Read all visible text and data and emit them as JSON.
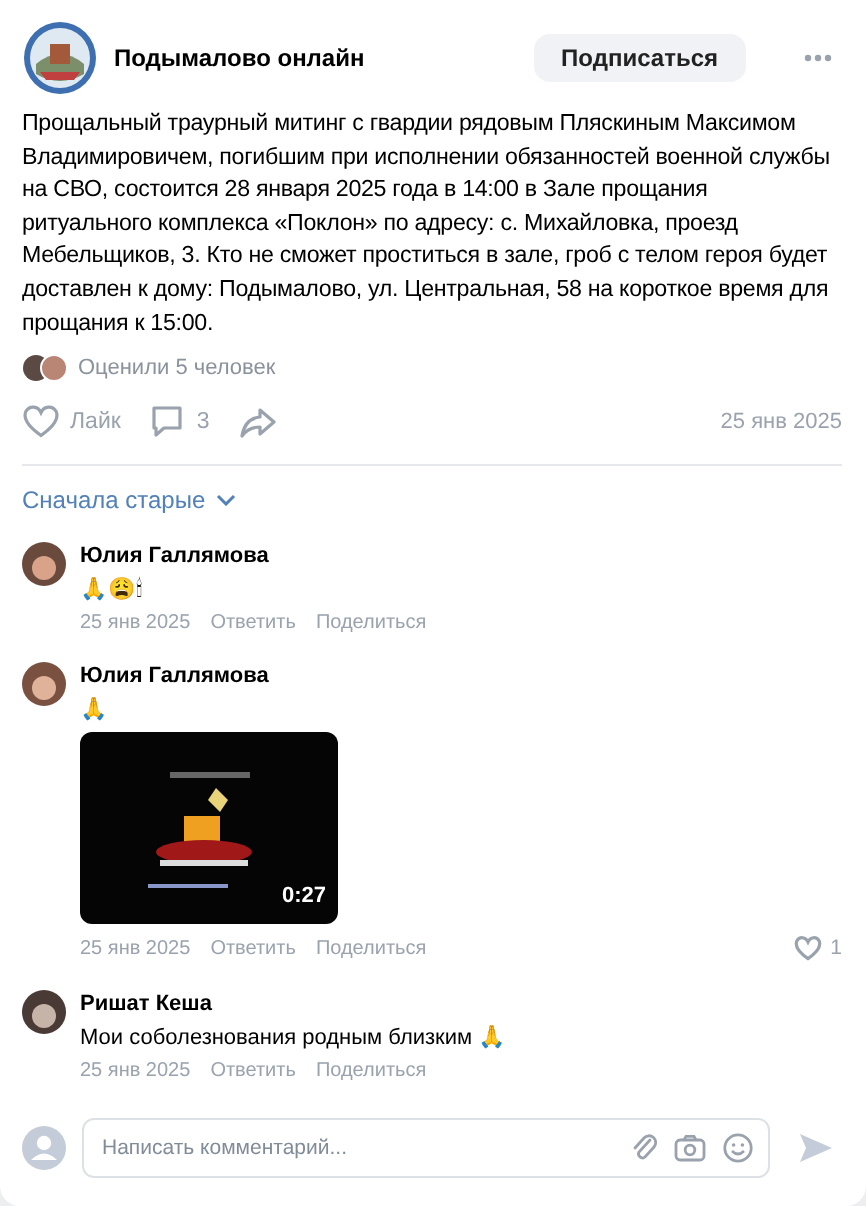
{
  "post": {
    "group_name": "Подымалово онлайн",
    "subscribe_button": "Подписаться",
    "text": "Прощальный траурный митинг с гвардии рядовым Пляскиным Максимом Владимировичем, погибшим при исполнении обязанностей военной службы на СВО, состоится 28 января 2025 года в 14:00 в Зале прощания ритуального комплекса «Поклон» по адресу: с. Михайловка, проезд Мебельщиков, 3. Кто не сможет проститься в зале, гроб с телом героя будет доставлен к дому: Подымалово, ул. Центральная, 58 на короткое время для прощания к 15:00.",
    "liked_by": "Оценили 5 человек",
    "like_label": "Лайк",
    "liked": false,
    "comment_count": "3",
    "date": "25 янв 2025"
  },
  "sort": {
    "label": "Сначала старые"
  },
  "comments": [
    {
      "author": "Юлия Галлямова",
      "text": "🙏😩🕯",
      "date": "25 янв 2025",
      "reply": "Ответить",
      "share": "Поделиться"
    },
    {
      "author": "Юлия Галлямова",
      "text": "🙏",
      "video": {
        "kind": "picture",
        "duration": "0:27"
      },
      "date": "25 янв 2025",
      "reply": "Ответить",
      "share": "Поделиться",
      "liked": false,
      "likes": "1"
    },
    {
      "author": "Ришат Кеша",
      "text": "Мои соболезнования родным близким 🙏",
      "date": "25 янв 2025",
      "reply": "Ответить",
      "share": "Поделиться"
    }
  ],
  "comment_input": {
    "placeholder": "Написать комментарий..."
  }
}
